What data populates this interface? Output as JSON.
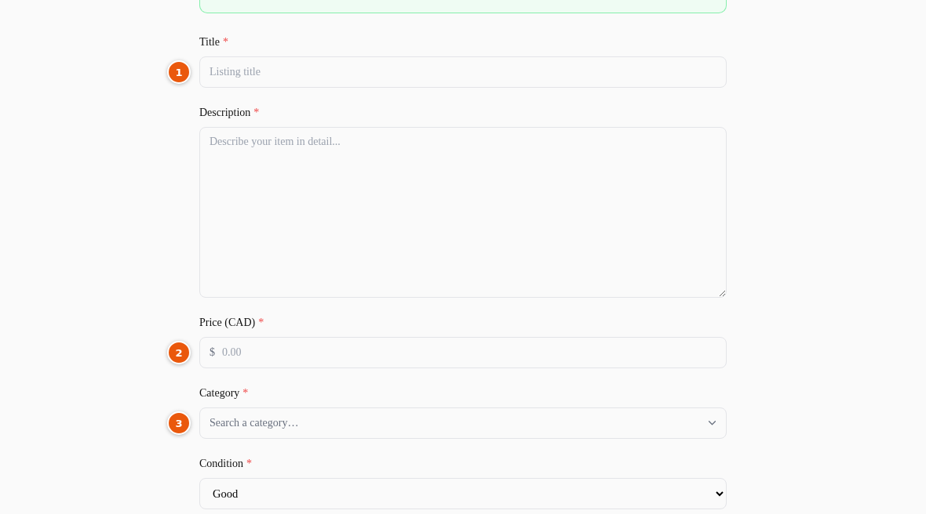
{
  "notice": {
    "kind": "success"
  },
  "fields": [
    {
      "kind": "text",
      "label": "Title",
      "required_mark": "*",
      "step": "1",
      "placeholder": "Listing title"
    },
    {
      "kind": "textarea",
      "label": "Description",
      "required_mark": "*",
      "placeholder": "Describe your item in detail..."
    },
    {
      "kind": "currency",
      "label": "Price (CAD)",
      "required_mark": "*",
      "step": "2",
      "prefix": "$",
      "placeholder": "0.00"
    },
    {
      "kind": "search-select",
      "label": "Category",
      "required_mark": "*",
      "step": "3",
      "placeholder": "Search a category…"
    },
    {
      "kind": "select",
      "label": "Condition",
      "required_mark": "*",
      "value": "Good"
    }
  ]
}
